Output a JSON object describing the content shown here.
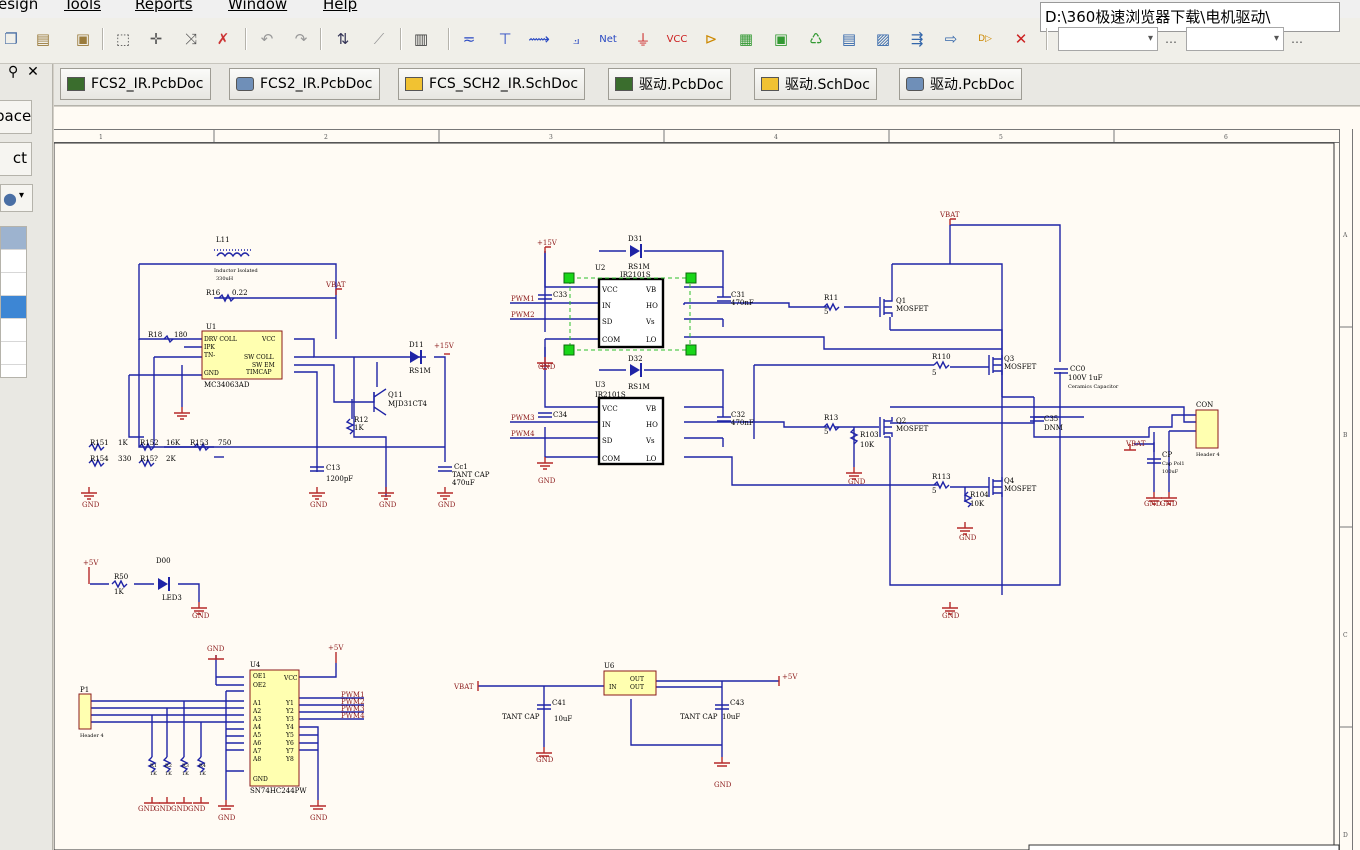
{
  "menu": [
    "esign",
    "Tools",
    "Reports",
    "Window",
    "Help"
  ],
  "path_field": "D:\\360极速浏览器下载\\电机驱动\\",
  "left_panel": {
    "pin_icon": "pin-icon",
    "close_icon": "close-icon",
    "buttons": [
      "pace",
      "ct"
    ]
  },
  "tabs": [
    {
      "label": "FCS2_IR.PcbDoc",
      "type": "pcb"
    },
    {
      "label": "FCS2_IR.PcbDoc",
      "type": "3d"
    },
    {
      "label": "FCS_SCH2_IR.SchDoc",
      "type": "sch"
    },
    {
      "label": "驱动.PcbDoc",
      "type": "pcb"
    },
    {
      "label": "驱动.SchDoc",
      "type": "sch"
    },
    {
      "label": "驱动.PcbDoc",
      "type": "3d"
    }
  ],
  "ruler": {
    "top": [
      "1",
      "2",
      "3",
      "4",
      "5",
      "6"
    ],
    "right": [
      "A",
      "B",
      "C",
      "D"
    ]
  },
  "schematic": {
    "nets": {
      "vbat": "VBAT",
      "p15v": "+15V",
      "p5v": "+5V",
      "gnd": "GND",
      "pwm1": "PWM1",
      "pwm2": "PWM2",
      "pwm3": "PWM3",
      "pwm4": "PWM4"
    },
    "components": {
      "l11": "L11",
      "l11_desc": "Inductor Isolated",
      "l11_val": "330uH",
      "r16": "R16",
      "r16_val": "0.22",
      "r18": "R18",
      "r18_val": "180",
      "u1": "U1",
      "u1_part": "MC34063AD",
      "u1_pins_left": [
        "DRV COLL",
        "IPK",
        "TN-",
        "GND"
      ],
      "u1_pins_right": [
        "VCC",
        "SW COLL",
        "SW EM",
        "TIMCAP"
      ],
      "d11": "D11",
      "d11_val": "RS1M",
      "q11": "Q11",
      "q11_part": "MJD31CT4",
      "r12": "R12",
      "r12_val": "1K",
      "c13": "C13",
      "c13_val": "1200pF",
      "cc1": "Cc1",
      "cc1_val1": "TANT CAP",
      "cc1_val2": "470uF",
      "r151": "R151",
      "r151_val": "1K",
      "r152": "R152",
      "r152_val": "16K",
      "r153": "R153",
      "r153_val": "750",
      "r154": "R154",
      "r154_val": "330",
      "r15x": "R15?",
      "r15x_val": "2K",
      "d31": "D31",
      "d31_val": "RS1M",
      "d32": "D32",
      "d32_val": "RS1M",
      "u2": "U2",
      "u2_part": "IR2101S",
      "u3": "U3",
      "u3_part": "IR2101S",
      "drv_pins_left": [
        "VCC",
        "IN",
        "SD",
        "COM"
      ],
      "drv_pins_right": [
        "VB",
        "HO",
        "Vs",
        "LO"
      ],
      "c33": "C33",
      "c34": "C34",
      "c31": "C31",
      "c32": "C32",
      "c_val": "470nF",
      "r11": "R11",
      "r13": "R13",
      "r_gate_val": "5",
      "q1": "Q1",
      "q2": "Q2",
      "q3": "Q3",
      "q4": "Q4",
      "q_part": "MOSFET",
      "r110": "R110",
      "r113": "R113",
      "r103": "R103",
      "r104": "R104",
      "r_pd_val": "10K",
      "cc0": "CC0",
      "cc0_val1": "100V 1uF",
      "cc0_val2": "Ceramics Capacitor",
      "c35": "C35",
      "c35_val": "DNM",
      "con": "CON",
      "con_part": "Header 4",
      "cp": "CP",
      "cp_val1": "Cap Pol1",
      "cp_val2": "100uF",
      "r50": "R50",
      "r50_val": "1K",
      "d00": "D00",
      "d00_val": "LED3",
      "p1": "P1",
      "p1_part": "Header 4",
      "u4": "U4",
      "u4_part": "SN74HC244PW",
      "u4_pins_left": [
        "OE1",
        "OE2",
        "A1",
        "A2",
        "A3",
        "A4",
        "A5",
        "A6",
        "A7",
        "A8",
        "GND"
      ],
      "u4_pins_right": [
        "VCC",
        "Y1",
        "Y2",
        "Y3",
        "Y4",
        "Y5",
        "Y6",
        "Y7",
        "Y8"
      ],
      "r_pu": [
        "R1",
        "R2",
        "R3",
        "R4"
      ],
      "r_pu_val": "1K",
      "u6": "U6",
      "u6_pins": [
        "IN",
        "OUT",
        "OUT"
      ],
      "c41": "C41",
      "c41_val1": "TANT CAP",
      "c41_val2": "10uF",
      "c43": "C43",
      "c43_val1": "TANT CAP",
      "c43_val2": "10uF"
    }
  }
}
